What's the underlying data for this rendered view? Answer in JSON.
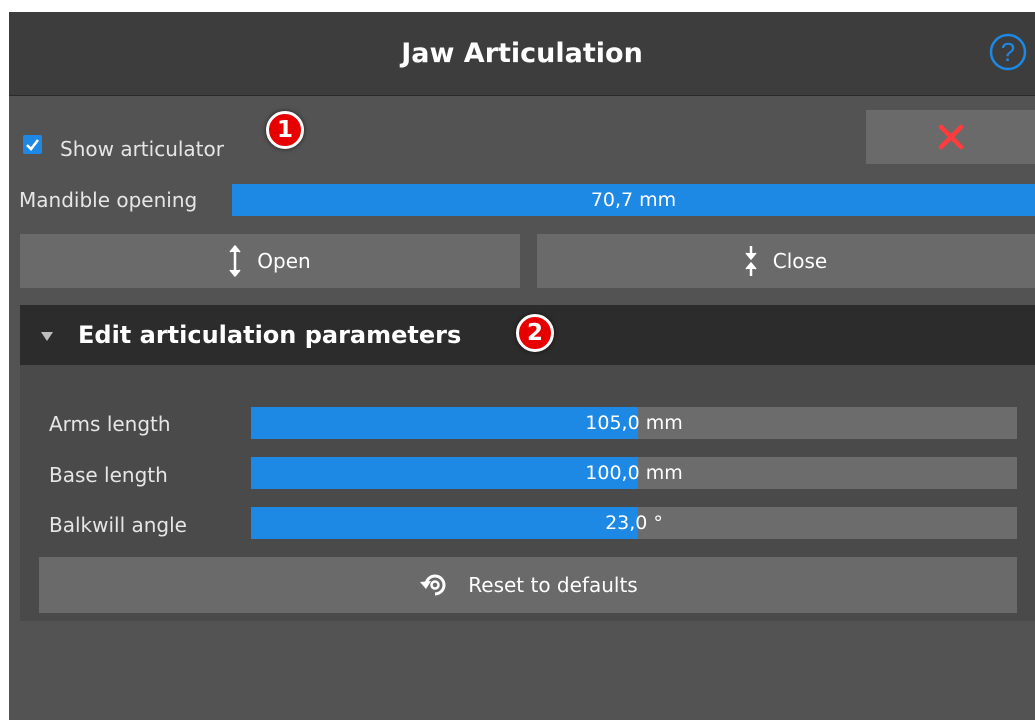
{
  "header": {
    "title": "Jaw Articulation",
    "help_icon": "help-circle-icon"
  },
  "top": {
    "show_articulator_label": "Show articulator",
    "show_articulator_checked": true,
    "badge_1": "1",
    "close_icon": "close-x-icon"
  },
  "mandible": {
    "label": "Mandible opening",
    "value": "70,7 mm",
    "fill_fraction": 1.0
  },
  "buttons": {
    "open_label": "Open",
    "close_label": "Close",
    "open_icon": "arrows-expand-vertical-icon",
    "close_icon": "arrows-collapse-vertical-icon"
  },
  "section": {
    "title": "Edit articulation parameters",
    "badge_2": "2",
    "expanded": true,
    "params": [
      {
        "label": "Arms length",
        "value": "105,0 mm",
        "fill_fraction": 0.505
      },
      {
        "label": "Base length",
        "value": "100,0 mm",
        "fill_fraction": 0.505
      },
      {
        "label": "Balkwill angle",
        "value": "23,0 °",
        "fill_fraction": 0.505
      }
    ],
    "reset_label": "Reset to defaults",
    "reset_icon": "reset-icon"
  },
  "colors": {
    "accent": "#1e88e5",
    "badge": "#e60000",
    "close_x": "#ff3b3b",
    "panel_bg": "#535353",
    "header_bg": "#3d3d3d"
  }
}
